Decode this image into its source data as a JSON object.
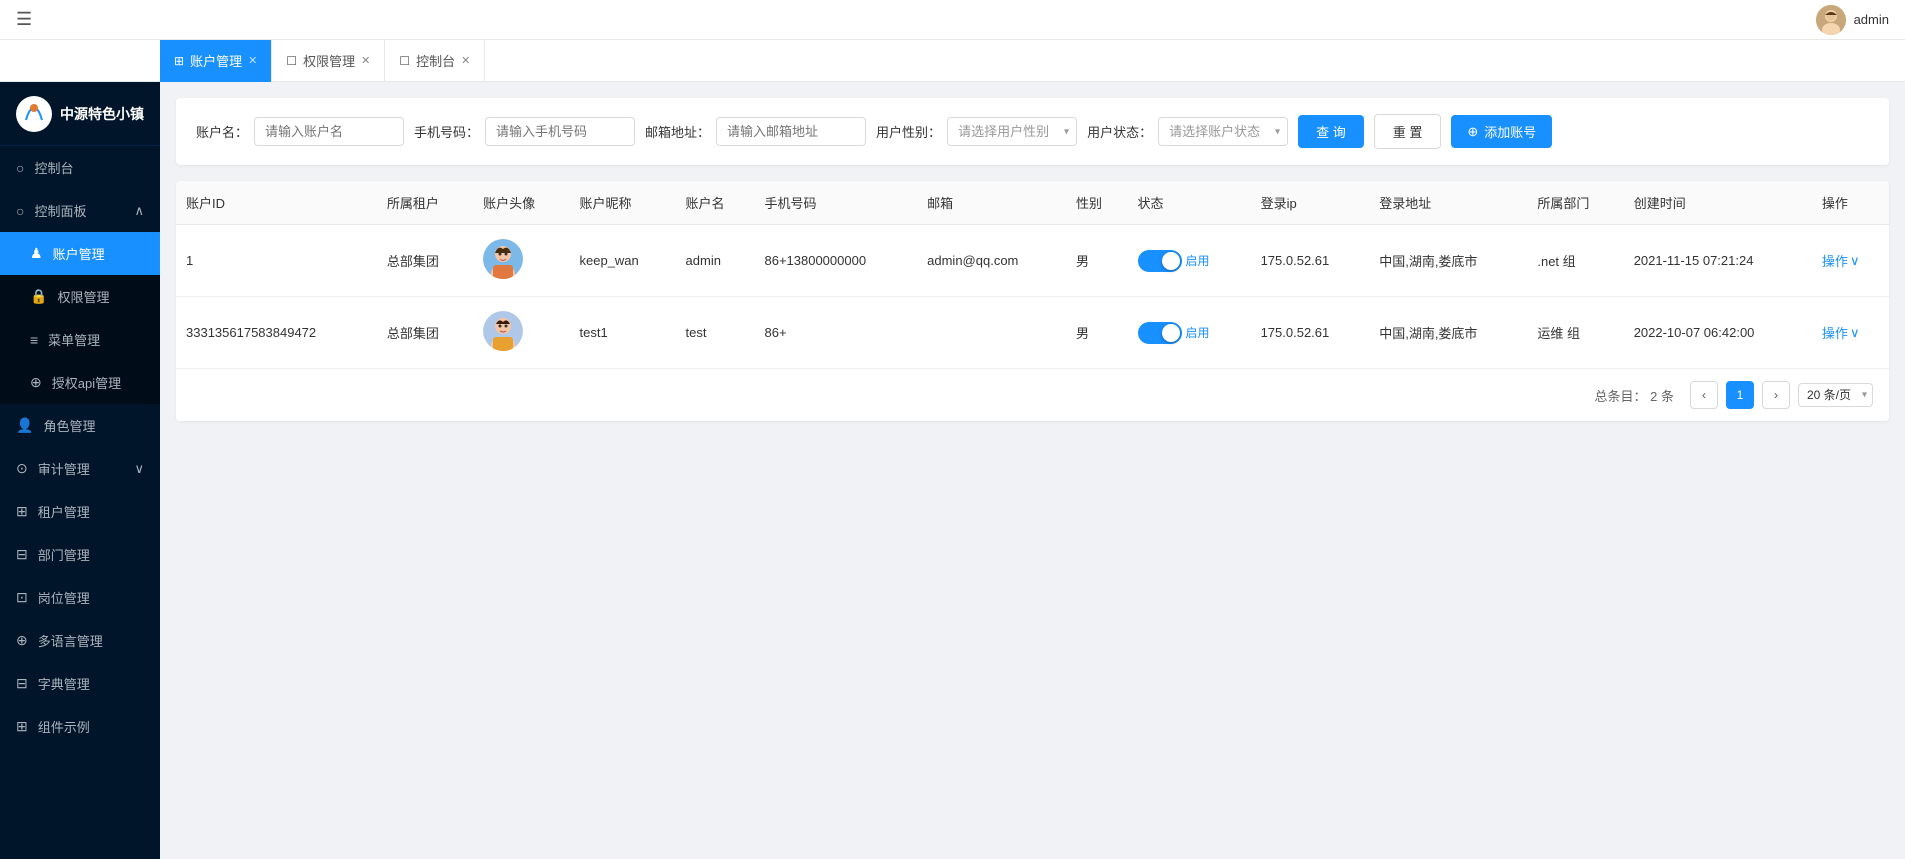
{
  "topbar": {
    "hamburger": "☰",
    "admin_name": "admin"
  },
  "tabs": [
    {
      "id": "account",
      "label": "账户管理",
      "icon": "⊞",
      "active": true,
      "closable": true
    },
    {
      "id": "permission",
      "label": "权限管理",
      "icon": "☐",
      "active": false,
      "closable": true
    },
    {
      "id": "console",
      "label": "控制台",
      "icon": "☐",
      "active": false,
      "closable": true
    }
  ],
  "sidebar": {
    "logo_text": "中源特色小镇",
    "items": [
      {
        "id": "dashboard",
        "label": "控制台",
        "icon": "○",
        "active": false
      },
      {
        "id": "control_panel",
        "label": "控制面板",
        "icon": "○",
        "active": false,
        "expandable": true,
        "expanded": true
      },
      {
        "id": "account_mgmt",
        "label": "账户管理",
        "icon": "♟",
        "active": true,
        "indent": true
      },
      {
        "id": "permission_mgmt",
        "label": "权限管理",
        "icon": "🔒",
        "active": false,
        "indent": true
      },
      {
        "id": "menu_mgmt",
        "label": "菜单管理",
        "icon": "≡",
        "active": false,
        "indent": true
      },
      {
        "id": "api_mgmt",
        "label": "授权api管理",
        "icon": "⊕",
        "active": false,
        "indent": true
      },
      {
        "id": "role_mgmt",
        "label": "角色管理",
        "icon": "👤",
        "active": false
      },
      {
        "id": "audit_mgmt",
        "label": "审计管理",
        "icon": "⊙",
        "active": false,
        "expandable": true
      },
      {
        "id": "tenant_mgmt",
        "label": "租户管理",
        "icon": "⊞",
        "active": false
      },
      {
        "id": "dept_mgmt",
        "label": "部门管理",
        "icon": "⊟",
        "active": false
      },
      {
        "id": "position_mgmt",
        "label": "岗位管理",
        "icon": "⊡",
        "active": false
      },
      {
        "id": "i18n_mgmt",
        "label": "多语言管理",
        "icon": "⊕",
        "active": false
      },
      {
        "id": "dict_mgmt",
        "label": "字典管理",
        "icon": "⊟",
        "active": false
      },
      {
        "id": "component_demo",
        "label": "组件示例",
        "icon": "⊞",
        "active": false
      }
    ]
  },
  "search": {
    "account_name_label": "账户名：",
    "account_name_placeholder": "请输入账户名",
    "phone_label": "手机号码：",
    "phone_placeholder": "请输入手机号码",
    "email_label": "邮箱地址：",
    "email_placeholder": "请输入邮箱地址",
    "gender_label": "用户性别：",
    "gender_placeholder": "请选择用户性别",
    "status_label": "用户状态：",
    "status_placeholder": "请选择账户状态",
    "query_btn": "查 询",
    "reset_btn": "重 置",
    "add_btn": "添加账号"
  },
  "table": {
    "columns": [
      "账户ID",
      "所属租户",
      "账户头像",
      "账户昵称",
      "账户名",
      "手机号码",
      "邮箱",
      "性别",
      "状态",
      "登录ip",
      "登录地址",
      "所属部门",
      "创建时间",
      "操作"
    ],
    "rows": [
      {
        "id": "1",
        "tenant": "总部集团",
        "avatar_type": "male_1",
        "nickname": "keep_wan",
        "username": "admin",
        "phone": "86+13800000000",
        "email": "admin@qq.com",
        "gender": "男",
        "status": "启用",
        "login_ip": "175.0.52.61",
        "login_addr": "中国,湖南,娄底市",
        "dept": ".net 组",
        "created_time": "2021-11-15 07:21:24",
        "op_label": "操作"
      },
      {
        "id": "333135617583849472",
        "tenant": "总部集团",
        "avatar_type": "male_2",
        "nickname": "test1",
        "username": "test",
        "phone": "86+",
        "email": "",
        "gender": "男",
        "status": "启用",
        "login_ip": "175.0.52.61",
        "login_addr": "中国,湖南,娄底市",
        "dept": "运维 组",
        "created_time": "2022-10-07 06:42:00",
        "op_label": "操作"
      }
    ]
  },
  "pagination": {
    "total_label": "总条目：",
    "total_count": "2 条",
    "current_page": "1",
    "per_page_label": "20 条/页"
  }
}
